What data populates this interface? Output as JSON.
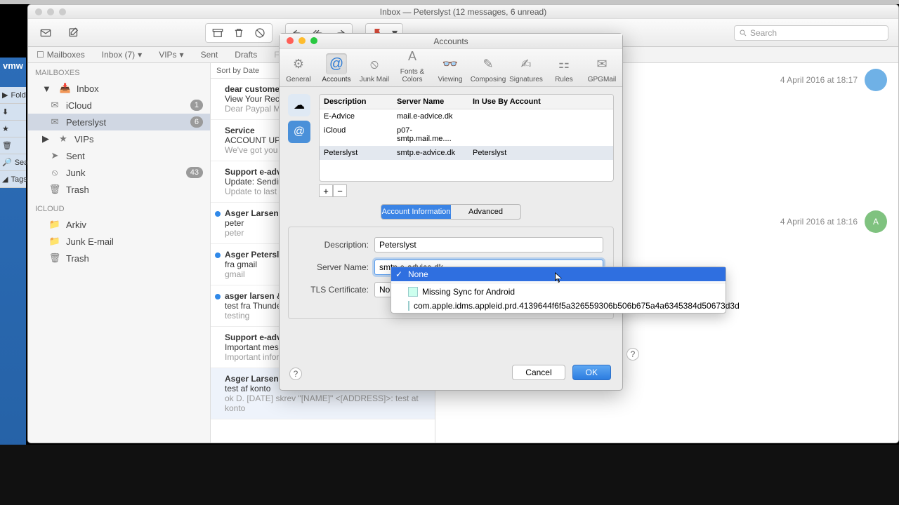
{
  "window": {
    "title": "Inbox — Peterslyst (12 messages, 6 unread)"
  },
  "toolbar": {
    "search_placeholder": "Search"
  },
  "favbar": {
    "mailboxes": "Mailboxes",
    "inbox": "Inbox (7)",
    "vips": "VIPs",
    "sent": "Sent",
    "drafts": "Drafts",
    "flagged": "Flagged"
  },
  "sidebar": {
    "header": "Mailboxes",
    "inbox": "Inbox",
    "icloud": "iCloud",
    "peterslyst": "Peterslyst",
    "vips": "VIPs",
    "sent": "Sent",
    "junk": "Junk",
    "trash": "Trash",
    "icloud_hdr": "iCloud",
    "arkiv": "Arkiv",
    "junkemail": "Junk E-mail",
    "trash2": "Trash",
    "badge_icloud": "1",
    "badge_peterslyst": "6",
    "badge_junk": "43"
  },
  "vmw": {
    "fold": "Fold",
    "sea": "Sea",
    "tags": "Tags"
  },
  "msglist": {
    "sort": "Sort by Date",
    "items": [
      {
        "from": "dear customer",
        "subj": "View Your Rece",
        "prev": "Dear Paypal Me been blocked. "
      },
      {
        "from": "Service",
        "subj": "ACCOUNT UPD",
        "prev": "We've got you PayPal accoun"
      },
      {
        "from": "Support e-adv",
        "subj": "Update: Sendin",
        "prev": "Update to last r your can send a"
      },
      {
        "from": "Asger Larsen &",
        "subj": "peter",
        "prev": "peter",
        "unread": true
      },
      {
        "from": "Asger Petersly",
        "subj": "fra gmail",
        "prev": "gmail",
        "unread": true
      },
      {
        "from": "asger larsen &",
        "subj": "test fra Thunde",
        "prev": "testing",
        "unread": true
      },
      {
        "from": "Support e-adv",
        "subj": "Important mess",
        "prev": "Important infor your mailprogra"
      },
      {
        "from": "Asger Larsen &",
        "subj": "test af konto",
        "prev": "ok D. [DATE] skrev \"[NAME]\" <[ADDRESS]>: test at konto",
        "sel": true
      }
    ]
  },
  "msgview": {
    "ts0": "4 April 2016 at 18:17",
    "ts1": "4 April 2016 at 18:16"
  },
  "acct": {
    "title": "Accounts",
    "tabs": [
      "General",
      "Accounts",
      "Junk Mail",
      "Fonts & Colors",
      "Viewing",
      "Composing",
      "Signatures",
      "Rules",
      "GPGMail"
    ],
    "cols": [
      "Description",
      "Server Name",
      "In Use By Account"
    ],
    "rows": [
      {
        "d": "E-Advice",
        "s": "mail.e-advice.dk",
        "u": ""
      },
      {
        "d": "iCloud",
        "s": "p07-smtp.mail.me....",
        "u": ""
      },
      {
        "d": "Peterslyst",
        "s": "smtp.e-advice.dk",
        "u": "Peterslyst",
        "sel": true
      }
    ],
    "seg": [
      "Account Information",
      "Advanced"
    ],
    "lbl_desc": "Description:",
    "lbl_srv": "Server Name:",
    "lbl_tls": "TLS Certificate:",
    "val_desc": "Peterslyst",
    "val_srv": "smtp.e-advice.dk",
    "val_tls_sel": "None",
    "btn_cancel": "Cancel",
    "btn_ok": "OK"
  },
  "dd": {
    "opts": [
      "None",
      "Missing Sync for Android",
      "com.apple.idms.appleid.prd.4139644f6f5a326559306b506b675a4a6345384d50673d3d"
    ]
  }
}
